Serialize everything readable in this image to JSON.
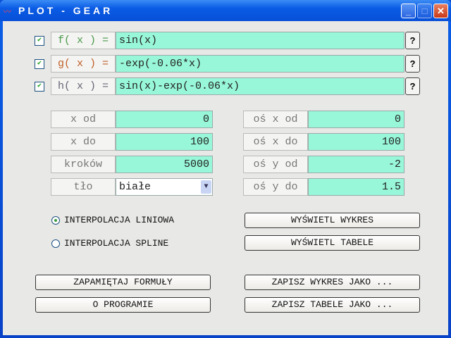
{
  "window": {
    "title": "PLOT - GEAR",
    "minimize": "_",
    "maximize": "□",
    "close": "✕"
  },
  "functions": [
    {
      "label": "f( x ) =",
      "value": "sin(x)",
      "checked": true,
      "help": "?",
      "color": "#4a9a4a"
    },
    {
      "label": "g( x ) =",
      "value": "-exp(-0.06*x)",
      "checked": true,
      "help": "?",
      "color": "#c0602a"
    },
    {
      "label": "h( x ) =",
      "value": "sin(x)-exp(-0.06*x)",
      "checked": true,
      "help": "?",
      "color": "#667"
    }
  ],
  "params_left": [
    {
      "label": "x od",
      "value": "0"
    },
    {
      "label": "x do",
      "value": "100"
    },
    {
      "label": "kroków",
      "value": "5000"
    },
    {
      "label": "tło",
      "value": "białe"
    }
  ],
  "params_right": [
    {
      "label": "oś x od",
      "value": "0"
    },
    {
      "label": "oś x do",
      "value": "100"
    },
    {
      "label": "oś y od",
      "value": "-2"
    },
    {
      "label": "oś y do",
      "value": "1.5"
    }
  ],
  "interpolation": [
    {
      "label": "INTERPOLACJA LINIOWA",
      "selected": true
    },
    {
      "label": "INTERPOLACJA SPLINE",
      "selected": false
    }
  ],
  "buttons": {
    "show_plot": "WYŚWIETL WYKRES",
    "show_table": "WYŚWIETL TABELE",
    "save_formulas": "ZAPAMIĘTAJ FORMUŁY",
    "about": "O PROGRAMIE",
    "save_plot": "ZAPISZ WYKRES JAKO ...",
    "save_table": "ZAPISZ TABELE JAKO ..."
  }
}
